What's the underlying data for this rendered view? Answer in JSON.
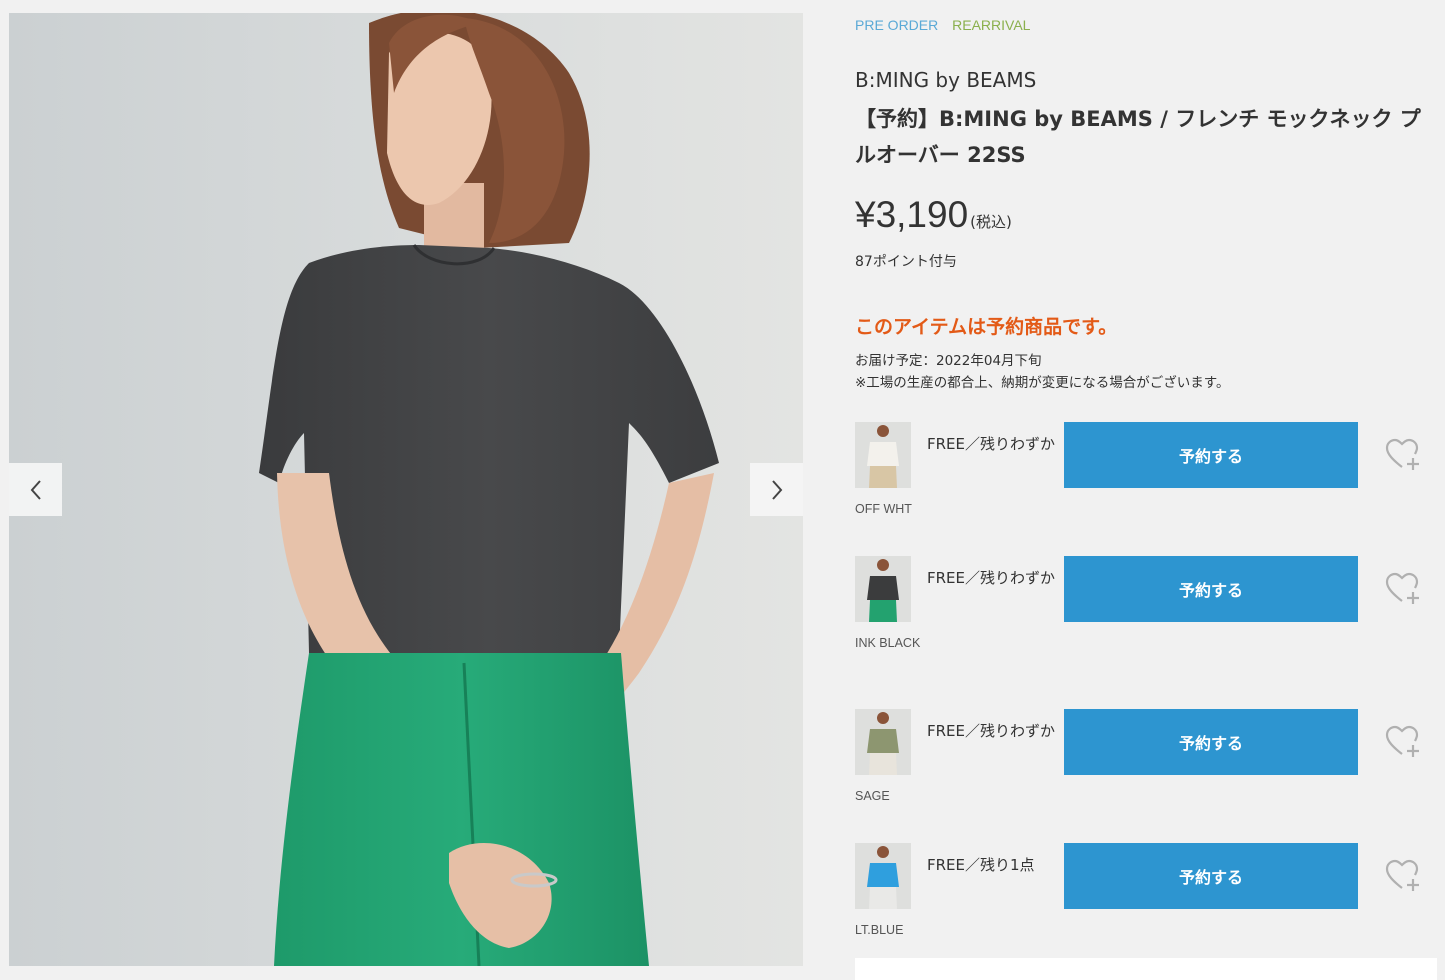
{
  "product": {
    "tags": [
      "PRE ORDER",
      "REARRIVAL"
    ],
    "brand": "B:MING by BEAMS",
    "title": "【予約】B:MING by BEAMS / フレンチ モックネック プルオーバー 22SS",
    "price": "¥3,190",
    "tax_note": "(税込)",
    "points": "87ポイント付与",
    "preorder_notice": "このアイテムは予約商品です。",
    "delivery_date": "お届け予定：2022年04月下旬",
    "delivery_note": "※工場の生産の都合上、納期が変更になる場合がございます。"
  },
  "gallery": {
    "prev_icon": "chevron-left-icon",
    "next_icon": "chevron-right-icon"
  },
  "variants": [
    {
      "color_name": "OFF WHT",
      "stock": "FREE／残りわずか",
      "button": "予約する",
      "shirt_color": "#f3f1ec",
      "pants_color": "#d8c6a5"
    },
    {
      "color_name": "INK BLACK",
      "stock": "FREE／残りわずか",
      "button": "予約する",
      "shirt_color": "#3b3c3d",
      "pants_color": "#23a26f"
    },
    {
      "color_name": "SAGE",
      "stock": "FREE／残りわずか",
      "button": "予約する",
      "shirt_color": "#8d9670",
      "pants_color": "#e8e4dc"
    },
    {
      "color_name": "LT.BLUE",
      "stock": "FREE／残り1点",
      "button": "予約する",
      "shirt_color": "#2f9fde",
      "pants_color": "#e9e9e7"
    }
  ],
  "colors": {
    "accent_button": "#2d95d0",
    "notice": "#e35a17",
    "tag_preorder": "#5aa9d6",
    "tag_rearrival": "#8bb04d"
  }
}
